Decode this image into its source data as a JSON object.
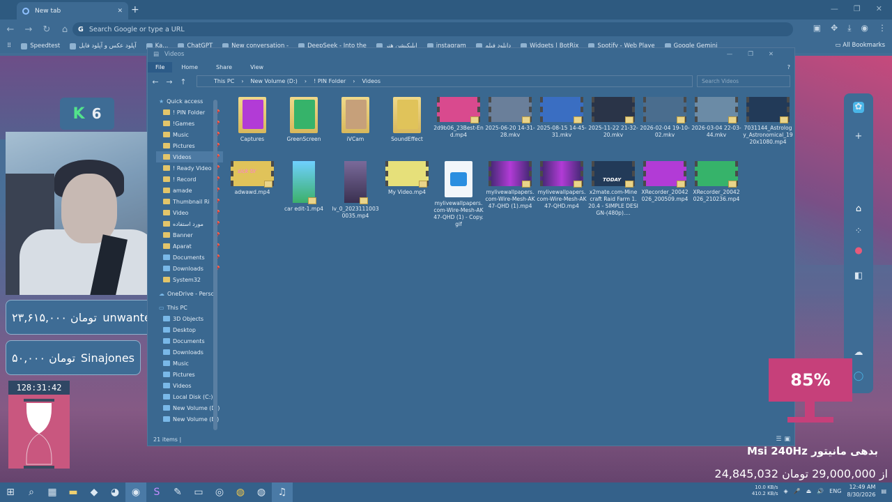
{
  "browser": {
    "tab_title": "New tab",
    "omnibox_placeholder": "Search Google or type a URL",
    "bookmarks": [
      "Speedtest",
      "آپلود عکس و آپلود فایل",
      "Ka...",
      "ChatGPT",
      "New conversation -",
      "DeepSeek - Into the",
      "اپلیکیشن هنر",
      "instagram",
      "دانلود فیلم",
      "Widgets | BotRix",
      "Spotify - Web Playe",
      "Google Gemini"
    ],
    "all_bookmarks": "All Bookmarks"
  },
  "explorer": {
    "title": "Videos",
    "ribbon": {
      "file": "File",
      "home": "Home",
      "share": "Share",
      "view": "View"
    },
    "path": [
      "This PC",
      "New Volume (D:)",
      "! PIN Folder",
      "Videos"
    ],
    "search_placeholder": "Search Videos",
    "status": "21 items",
    "nav": {
      "quick_access": "Quick access",
      "quick_items": [
        "! PIN Folder",
        "!Games",
        "Music",
        "Pictures",
        "Videos",
        "! Ready Video",
        "! Record",
        "amade",
        "Thumbnail Ri",
        "Video",
        "مورد استفاده",
        "Banner",
        "Aparat",
        "Documents",
        "Downloads",
        "System32"
      ],
      "onedrive": "OneDrive - Person",
      "thispc": "This PC",
      "pc_items": [
        "3D Objects",
        "Desktop",
        "Documents",
        "Downloads",
        "Music",
        "Pictures",
        "Videos",
        "Local Disk (C:)",
        "New Volume (D:)",
        "New Volume (E:)"
      ]
    },
    "items_row1": [
      {
        "name": "Captures",
        "kind": "folder"
      },
      {
        "name": "GreenScreen",
        "kind": "folder"
      },
      {
        "name": "iVCam",
        "kind": "folder"
      },
      {
        "name": "SoundEffect",
        "kind": "folder"
      },
      {
        "name": "2d9b06_23Best-End.mp4",
        "kind": "video"
      },
      {
        "name": "2025-06-20 14-31-28.mkv",
        "kind": "video"
      },
      {
        "name": "2025-08-15 14-45-31.mkv",
        "kind": "video"
      },
      {
        "name": "2025-11-22 21-32-20.mkv",
        "kind": "video"
      },
      {
        "name": "2026-02-04 19-10-02.mkv",
        "kind": "video"
      },
      {
        "name": "2026-03-04 22-03-44.mkv",
        "kind": "video"
      },
      {
        "name": "7031144_Astrology_Astronomical_1920x1080.mp4",
        "kind": "video"
      }
    ],
    "items_row2": [
      {
        "name": "adwawd.mp4",
        "kind": "video"
      },
      {
        "name": "car edit-1.mp4",
        "kind": "tall"
      },
      {
        "name": "lv_0_20231110030035.mp4",
        "kind": "tall"
      },
      {
        "name": "My Video.mp4",
        "kind": "video"
      },
      {
        "name": "mylivewallpapers.com-Wire-Mesh-AK47-QHD (1) - Copy.gif",
        "kind": "gif"
      },
      {
        "name": "mylivewallpapers.com-Wire-Mesh-AK47-QHD (1).mp4",
        "kind": "video"
      },
      {
        "name": "mylivewallpapers.com-Wire-Mesh-AK47-QHD.mp4",
        "kind": "video"
      },
      {
        "name": "x2mate.com-Minecraft Raid Farm 1.20.4 - SIMPLE DESIGN-(480p)....",
        "kind": "video"
      },
      {
        "name": "XRecorder_20042026_200509.mp4",
        "kind": "video"
      },
      {
        "name": "XRecorder_20042026_210236.mp4",
        "kind": "video"
      }
    ],
    "thumb_texts": {
      "adwawd": "sick tir",
      "x2mate": "TODAY"
    }
  },
  "stream": {
    "k_count": "6",
    "donations": [
      {
        "name": "unwanted",
        "amount": "۲۳,۶۱۵,۰۰۰ تومان"
      },
      {
        "name": "Sinajones",
        "amount": "۵۰,۰۰۰ تومان"
      }
    ],
    "timer": "128:31:42",
    "goal_percent": "85%",
    "goal_title": "Msi 240Hz بدهی مانیتور",
    "goal_amount": "24,845,032 از 29,000,000 تومان"
  },
  "taskbar": {
    "net_up": "10.0 KB/s",
    "net_down": "410.2 KB/s",
    "lang": "ENG",
    "time": "12:49 AM",
    "date": "8/30/2026"
  }
}
